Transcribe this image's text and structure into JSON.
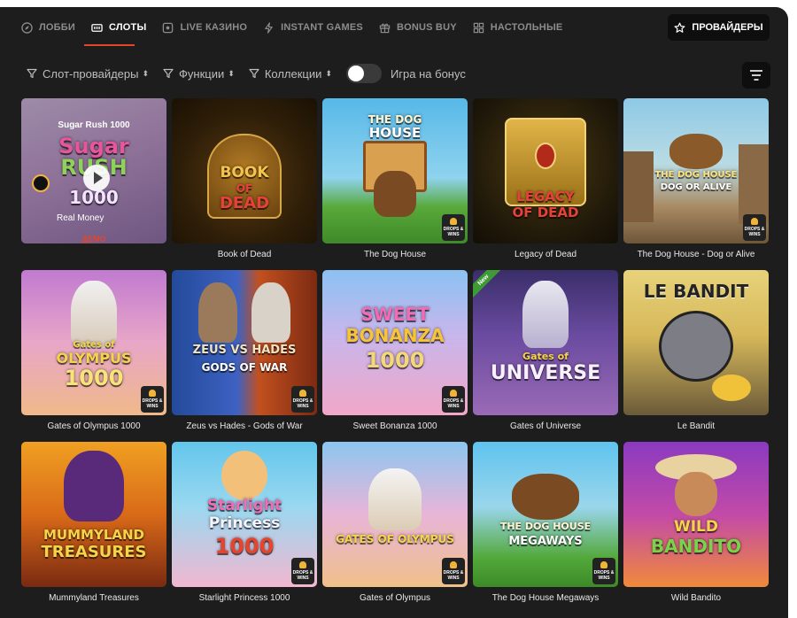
{
  "tabs": [
    {
      "label": "ЛОББИ",
      "icon": "compass-icon"
    },
    {
      "label": "СЛОТЫ",
      "icon": "slot-machine-icon"
    },
    {
      "label": "LIVE КАЗИНО",
      "icon": "live-casino-icon"
    },
    {
      "label": "INSTANT GAMES",
      "icon": "lightning-icon"
    },
    {
      "label": "BONUS BUY",
      "icon": "gift-icon"
    },
    {
      "label": "НАСТОЛЬНЫЕ",
      "icon": "grid-icon"
    }
  ],
  "active_tab": "СЛОТЫ",
  "providers_button": "ПРОВАЙДЕРЫ",
  "filters": [
    {
      "label": "Слот-провайдеры"
    },
    {
      "label": "Функции"
    },
    {
      "label": "Коллекции"
    }
  ],
  "bonus_toggle": {
    "label": "Игра на бонус",
    "on": false
  },
  "featured": {
    "title": "Sugar Rush 1000",
    "line1": "Sugar",
    "line2": "RUSH",
    "line3": "1000",
    "real_money": "Real Money",
    "demo": "ДЕМО"
  },
  "badges": {
    "drops_wins": "DROPS & WINS",
    "new": "New"
  },
  "games": [
    {
      "title": "Book of Dead",
      "logo": [
        "BOOK",
        "OF",
        "DEAD"
      ]
    },
    {
      "title": "The Dog House",
      "logo": [
        "THE DOG",
        "HOUSE"
      ]
    },
    {
      "title": "Legacy of Dead",
      "logo": [
        "LEGACY",
        "OF DEAD"
      ]
    },
    {
      "title": "The Dog House - Dog or Alive",
      "logo": [
        "THE DOG HOUSE",
        "DOG OR ALIVE"
      ]
    },
    {
      "title": "Gates of Olympus 1000",
      "logo": [
        "Gates of",
        "OLYMPUS",
        "1000"
      ]
    },
    {
      "title": "Zeus vs Hades - Gods of War",
      "logo": [
        "ZEUS VS HADES",
        "GODS OF WAR"
      ]
    },
    {
      "title": "Sweet Bonanza 1000",
      "logo": [
        "SWEET",
        "BONANZA",
        "1000"
      ]
    },
    {
      "title": "Gates of Universe",
      "logo": [
        "Gates of",
        "UNIVERSE"
      ]
    },
    {
      "title": "Le Bandit",
      "logo": [
        "LE BANDIT"
      ]
    },
    {
      "title": "Mummyland Treasures",
      "logo": [
        "MUMMYLAND",
        "TREASURES"
      ]
    },
    {
      "title": "Starlight Princess 1000",
      "logo": [
        "Starlight",
        "Princess",
        "1000"
      ]
    },
    {
      "title": "Gates of Olympus",
      "logo": [
        "GATES OF OLYMPUS"
      ]
    },
    {
      "title": "The Dog House Megaways",
      "logo": [
        "THE DOG HOUSE",
        "MEGAWAYS"
      ]
    },
    {
      "title": "Wild Bandito",
      "logo": [
        "WILD",
        "BANDITO"
      ]
    }
  ],
  "colors": {
    "accent": "#e8432c",
    "panel": "#1d1d1d",
    "button": "#0e0e0e"
  }
}
